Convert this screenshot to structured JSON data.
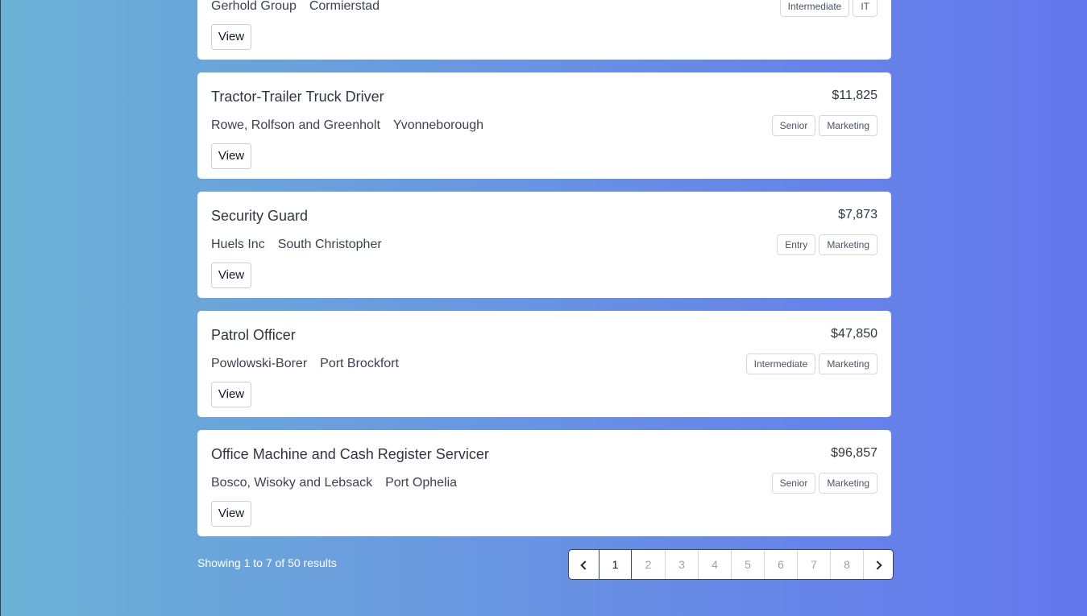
{
  "jobs": [
    {
      "title": "",
      "salary": "",
      "company": "Gerhold Group",
      "location": "Cormierstad",
      "tags": [
        "Intermediate",
        "IT"
      ],
      "view_label": "View"
    },
    {
      "title": "Tractor-Trailer Truck Driver",
      "salary": "$11,825",
      "company": "Rowe, Rolfson and Greenholt",
      "location": "Yvonneborough",
      "tags": [
        "Senior",
        "Marketing"
      ],
      "view_label": "View"
    },
    {
      "title": "Security Guard",
      "salary": "$7,873",
      "company": "Huels Inc",
      "location": "South Christopher",
      "tags": [
        "Entry",
        "Marketing"
      ],
      "view_label": "View"
    },
    {
      "title": "Patrol Officer",
      "salary": "$47,850",
      "company": "Powlowski-Borer",
      "location": "Port Brockfort",
      "tags": [
        "Intermediate",
        "Marketing"
      ],
      "view_label": "View"
    },
    {
      "title": "Office Machine and Cash Register Servicer",
      "salary": "$96,857",
      "company": "Bosco, Wisoky and Lebsack",
      "location": "Port Ophelia",
      "tags": [
        "Senior",
        "Marketing"
      ],
      "view_label": "View"
    }
  ],
  "results": {
    "text": "Showing 1 to 7 of 50 results"
  },
  "pagination": {
    "pages": [
      "1",
      "2",
      "3",
      "4",
      "5",
      "6",
      "7",
      "8"
    ],
    "current": "1",
    "prev_icon": "chevron-left-icon",
    "next_icon": "chevron-right-icon"
  }
}
